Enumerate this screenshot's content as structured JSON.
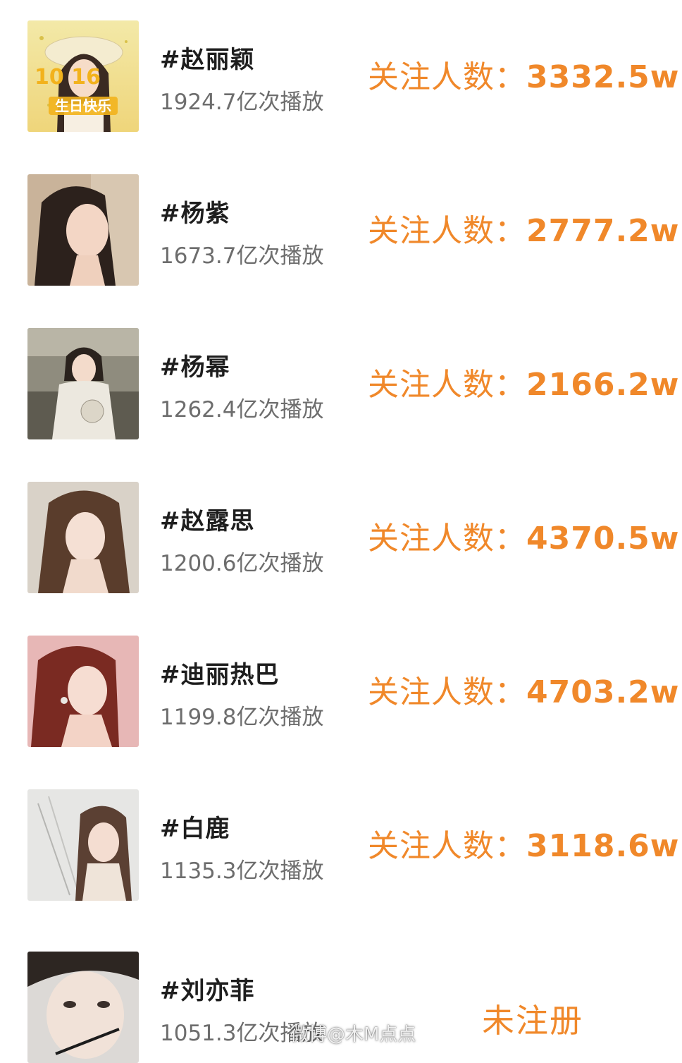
{
  "rows": [
    {
      "name": "#赵丽颖",
      "plays": "1924.7亿次播放",
      "followers_label": "关注人数：",
      "followers_value": "3332.5w",
      "avatar_badge": "生日快乐",
      "avatar_number": "10  16"
    },
    {
      "name": "#杨紫",
      "plays": "1673.7亿次播放",
      "followers_label": "关注人数：",
      "followers_value": "2777.2w"
    },
    {
      "name": "#杨幂",
      "plays": "1262.4亿次播放",
      "followers_label": "关注人数：",
      "followers_value": "2166.2w"
    },
    {
      "name": "#赵露思",
      "plays": "1200.6亿次播放",
      "followers_label": "关注人数：",
      "followers_value": "4370.5w"
    },
    {
      "name": "#迪丽热巴",
      "plays": "1199.8亿次播放",
      "followers_label": "关注人数：",
      "followers_value": "4703.2w"
    },
    {
      "name": "#白鹿",
      "plays": "1135.3亿次播放",
      "followers_label": "关注人数：",
      "followers_value": "3118.6w"
    },
    {
      "name": "#刘亦菲",
      "plays": "1051.3亿次播放",
      "status": "未注册"
    }
  ],
  "watermark": "微博@木M点点",
  "colors": {
    "accent": "#f0882a",
    "name_text": "#1e1e1e",
    "plays_text": "#6d6d6d",
    "background": "#ffffff"
  }
}
